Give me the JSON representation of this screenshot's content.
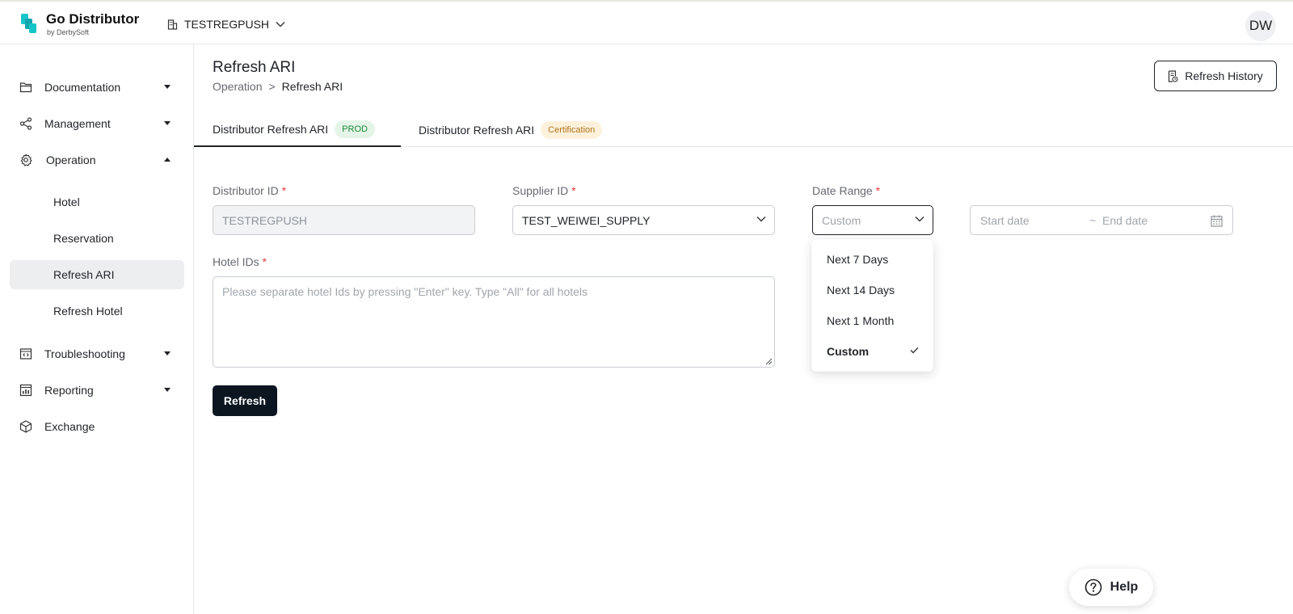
{
  "header": {
    "brand_name": "Go Distributor",
    "brand_sub": "by DerbySoft",
    "account": "TESTREGPUSH",
    "avatar": "DW",
    "brand_color": "#16c5c9"
  },
  "sidebar": {
    "items": [
      {
        "label": "Documentation",
        "icon": "folder-icon",
        "caret": "down"
      },
      {
        "label": "Management",
        "icon": "share-icon",
        "caret": "down"
      },
      {
        "label": "Operation",
        "icon": "gear-icon",
        "caret": "up"
      },
      {
        "label": "Troubleshooting",
        "icon": "code-window-icon",
        "caret": "down"
      },
      {
        "label": "Reporting",
        "icon": "bar-chart-icon",
        "caret": "down"
      },
      {
        "label": "Exchange",
        "icon": "cube-icon"
      }
    ],
    "operation_sub": [
      {
        "label": "Hotel"
      },
      {
        "label": "Reservation"
      },
      {
        "label": "Refresh ARI",
        "active": true
      },
      {
        "label": "Refresh Hotel"
      }
    ]
  },
  "page": {
    "title": "Refresh ARI",
    "breadcrumb": [
      "Operation",
      ">",
      "Refresh ARI"
    ],
    "history_button": "Refresh History"
  },
  "tabs": [
    {
      "label": "Distributor Refresh ARI",
      "badge": "PROD",
      "active": true
    },
    {
      "label": "Distributor Refresh ARI",
      "badge": "Certification",
      "active": false
    }
  ],
  "form": {
    "distributor_id": {
      "label": "Distributor ID",
      "required": "*",
      "value": "TESTREGPUSH"
    },
    "supplier_id": {
      "label": "Supplier ID",
      "required": "*",
      "value": "TEST_WEIWEI_SUPPLY"
    },
    "date_range": {
      "label": "Date Range",
      "required": "*",
      "value": "Custom"
    },
    "date_picker": {
      "start_placeholder": "Start date",
      "separator": "~",
      "end_placeholder": "End date"
    },
    "hotel_ids": {
      "label": "Hotel IDs",
      "required": "*",
      "placeholder": "Please separate hotel Ids by pressing \"Enter\" key. Type \"All\" for all hotels"
    },
    "submit": "Refresh"
  },
  "date_range_dropdown": {
    "options": [
      "Next 7 Days",
      "Next 14 Days",
      "Next 1 Month",
      "Custom"
    ],
    "selected": "Custom"
  },
  "help": {
    "label": "Help"
  }
}
